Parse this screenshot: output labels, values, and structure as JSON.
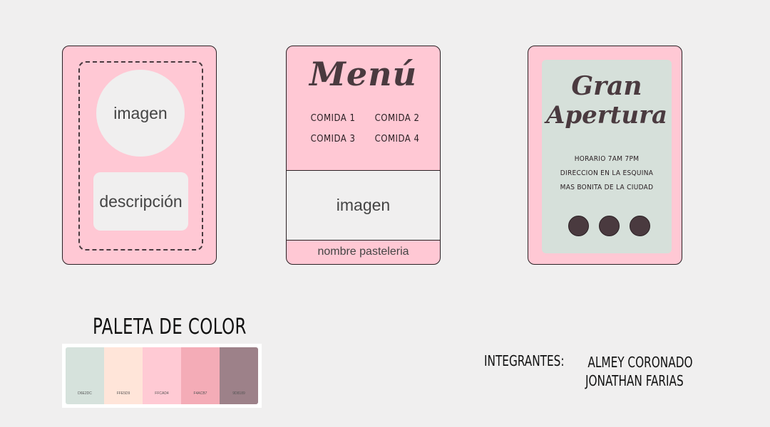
{
  "card1": {
    "image_label": "imagen",
    "description_label": "descripción"
  },
  "card2": {
    "title": "Menú",
    "items": [
      "COMIDA 1",
      "COMIDA 2",
      "COMIDA 3",
      "COMIDA 4"
    ],
    "image_label": "imagen",
    "footer": "nombre pasteleria"
  },
  "card3": {
    "title_line1": "Gran",
    "title_line2": "Apertura",
    "info": [
      "HORARIO 7AM 7PM",
      "DIRECCION EN LA ESQUINA",
      "MAS BONITA DE LA CIUDAD"
    ]
  },
  "palette": {
    "title": "PALETA DE COLOR",
    "swatches": [
      {
        "hex": "D6E2DC",
        "color": "#d6e2dc"
      },
      {
        "hex": "FFE5D9",
        "color": "#ffe5d9"
      },
      {
        "hex": "FFCAD4",
        "color": "#ffcad4"
      },
      {
        "hex": "F4ACB7",
        "color": "#f4acb7"
      },
      {
        "hex": "9D8189",
        "color": "#9d8189"
      }
    ]
  },
  "members": {
    "label": "INTEGRANTES:",
    "names": [
      "ALMEY CORONADO",
      "JONATHAN FARIAS"
    ]
  },
  "colors": {
    "card_pink": "#ffc8d4",
    "mint": "#d6e0da",
    "dark": "#4a3a3f",
    "background": "#f0efef"
  }
}
